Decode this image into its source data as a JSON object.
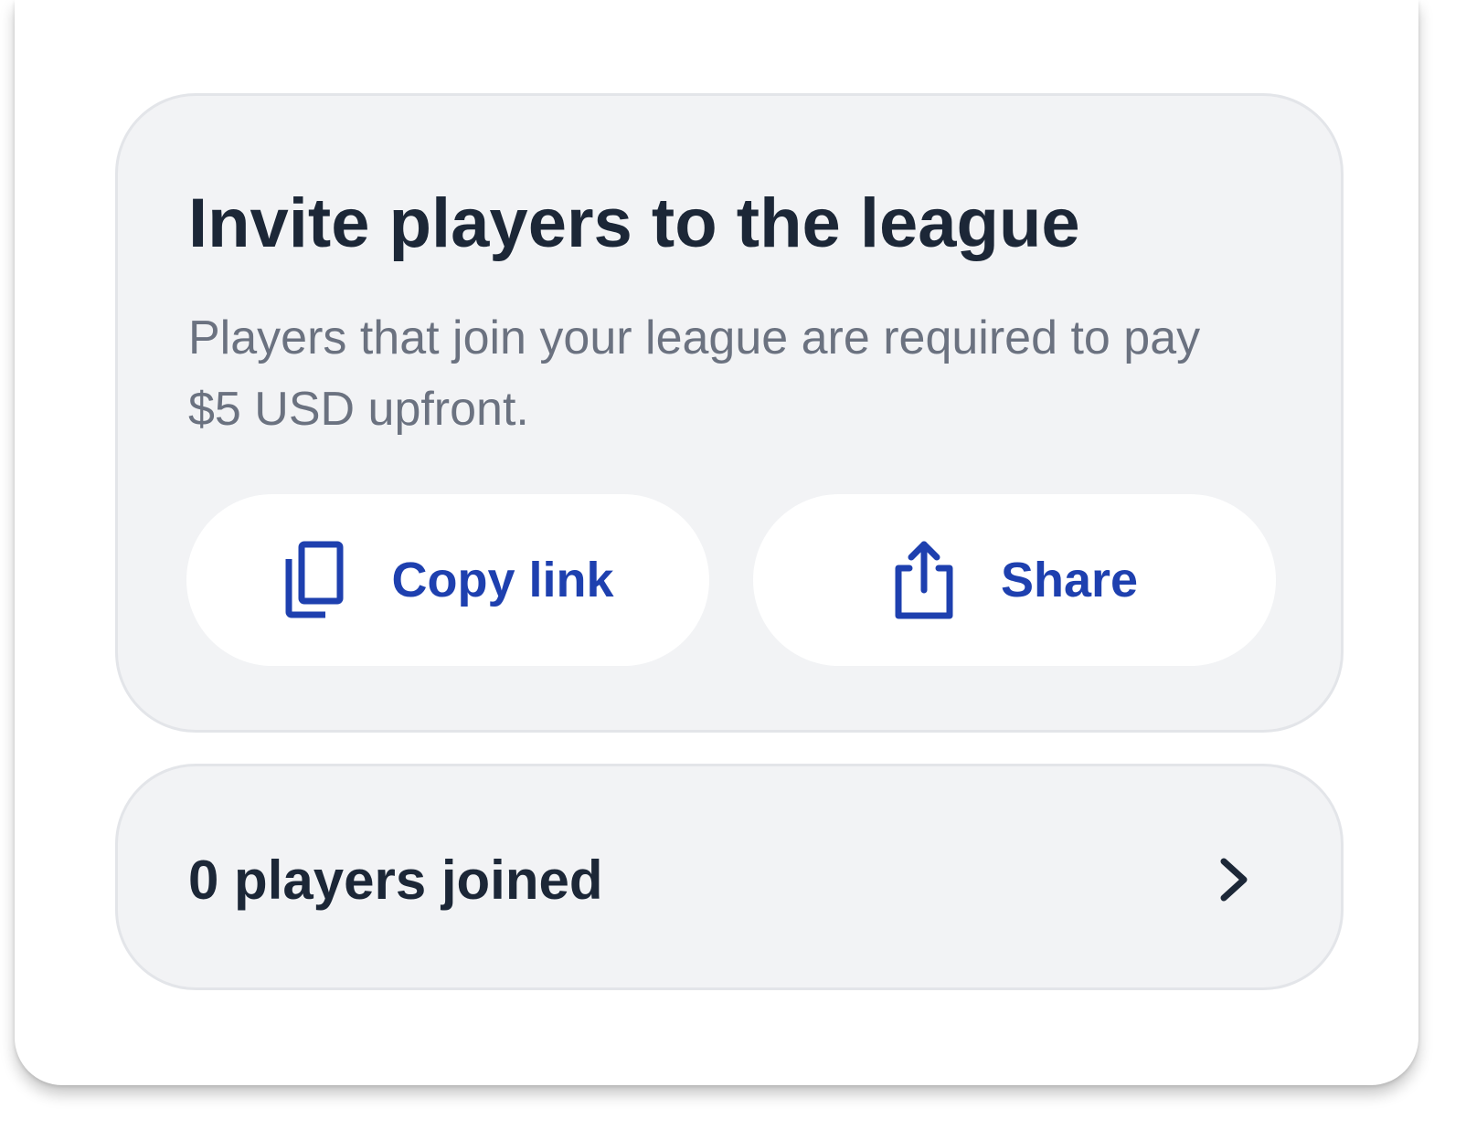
{
  "invite": {
    "title": "Invite players to the league",
    "description": "Players that join your league are required to pay $5 USD upfront.",
    "copy_button": {
      "label": "Copy link",
      "icon": "copy-icon"
    },
    "share_button": {
      "label": "Share",
      "icon": "share-icon"
    }
  },
  "joined": {
    "label": "0 players joined",
    "icon": "chevron-right-icon"
  },
  "colors": {
    "panel_bg": "#f2f3f5",
    "title": "#1c2737",
    "description": "#6b7280",
    "accent": "#1e40af"
  }
}
